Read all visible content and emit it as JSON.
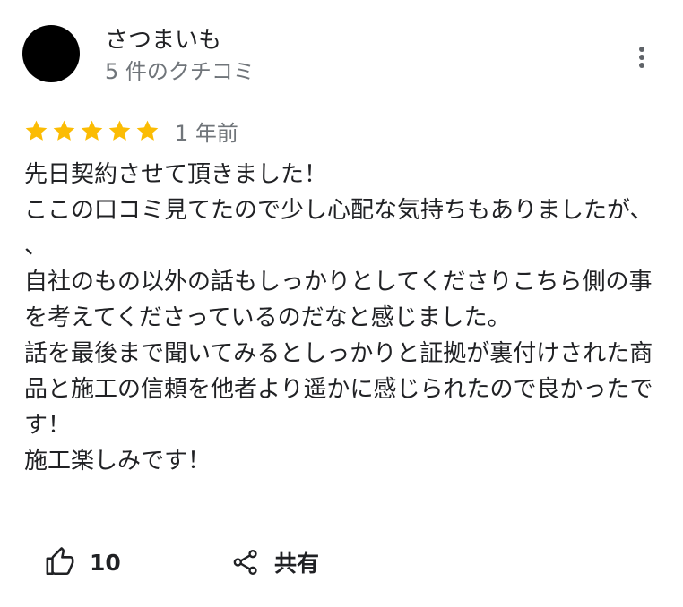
{
  "reviewer": {
    "name": "さつまいも",
    "review_count": "5 件のクチコミ",
    "avatar_color": "#000000"
  },
  "more_options_icon": "more-vert-icon",
  "rating": {
    "stars": 5,
    "max_stars": 5,
    "star_color": "#fbbc04",
    "time": "1 年前"
  },
  "review": {
    "lines": [
      "先日契約させて頂きました！",
      "ここの口コミ見てたので少し心配な気持ちもありましたが、、",
      "自社のもの以外の話もしっかりとしてくださりこちら側の事を考えてくださっているのだなと感じました。",
      "話を最後まで聞いてみるとしっかりと証拠が裏付けされた商品と施工の信頼を他者より遥かに感じられたので良かったです！",
      "施工楽しみです！"
    ]
  },
  "actions": {
    "like": {
      "icon": "thumbs-up-icon",
      "count": "10"
    },
    "share": {
      "icon": "share-icon",
      "label": "共有"
    }
  }
}
